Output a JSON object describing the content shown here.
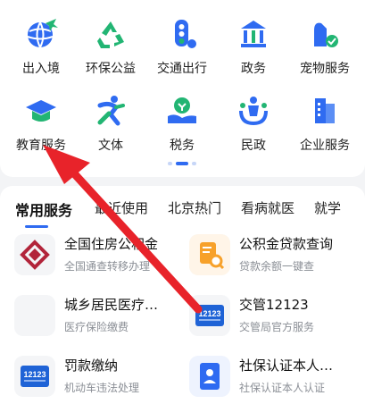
{
  "quick_grid": [
    {
      "label": "出入境",
      "icon": "globe-plane-icon"
    },
    {
      "label": "环保公益",
      "icon": "recycle-icon"
    },
    {
      "label": "交通出行",
      "icon": "traffic-light-icon"
    },
    {
      "label": "政务",
      "icon": "government-building-icon"
    },
    {
      "label": "宠物服务",
      "icon": "pet-icon"
    },
    {
      "label": "教育服务",
      "icon": "graduation-cap-icon"
    },
    {
      "label": "文体",
      "icon": "running-person-icon"
    },
    {
      "label": "税务",
      "icon": "tax-hand-icon"
    },
    {
      "label": "民政",
      "icon": "people-icon"
    },
    {
      "label": "企业服务",
      "icon": "enterprise-building-icon"
    }
  ],
  "tabs": [
    {
      "label": "常用服务",
      "active": true
    },
    {
      "label": "最近使用",
      "active": false
    },
    {
      "label": "北京热门",
      "active": false
    },
    {
      "label": "看病就医",
      "active": false
    },
    {
      "label": "就学",
      "active": false
    }
  ],
  "services": [
    {
      "title": "全国住房公积金",
      "subtitle": "全国通查转移办理",
      "icon": "housing-fund-icon"
    },
    {
      "title": "公积金贷款查询",
      "subtitle": "贷款余额一键查",
      "icon": "loan-document-icon"
    },
    {
      "title": "城乡居民医疗…",
      "subtitle": "医疗保险缴费",
      "icon": "medical-insurance-icon"
    },
    {
      "title": "交管12123",
      "subtitle": "交管局官方服务",
      "icon": "traffic-12123-icon"
    },
    {
      "title": "罚款缴纳",
      "subtitle": "机动车违法处理",
      "icon": "fine-12123-icon"
    },
    {
      "title": "社保认证本人…",
      "subtitle": "社保认证本人认证",
      "icon": "id-card-icon"
    }
  ],
  "colors": {
    "accent": "#2f6bf1",
    "green": "#22b573",
    "arrow": "#e8232a",
    "housing_red": "#b2243a",
    "loan_orange": "#f7a12a"
  }
}
